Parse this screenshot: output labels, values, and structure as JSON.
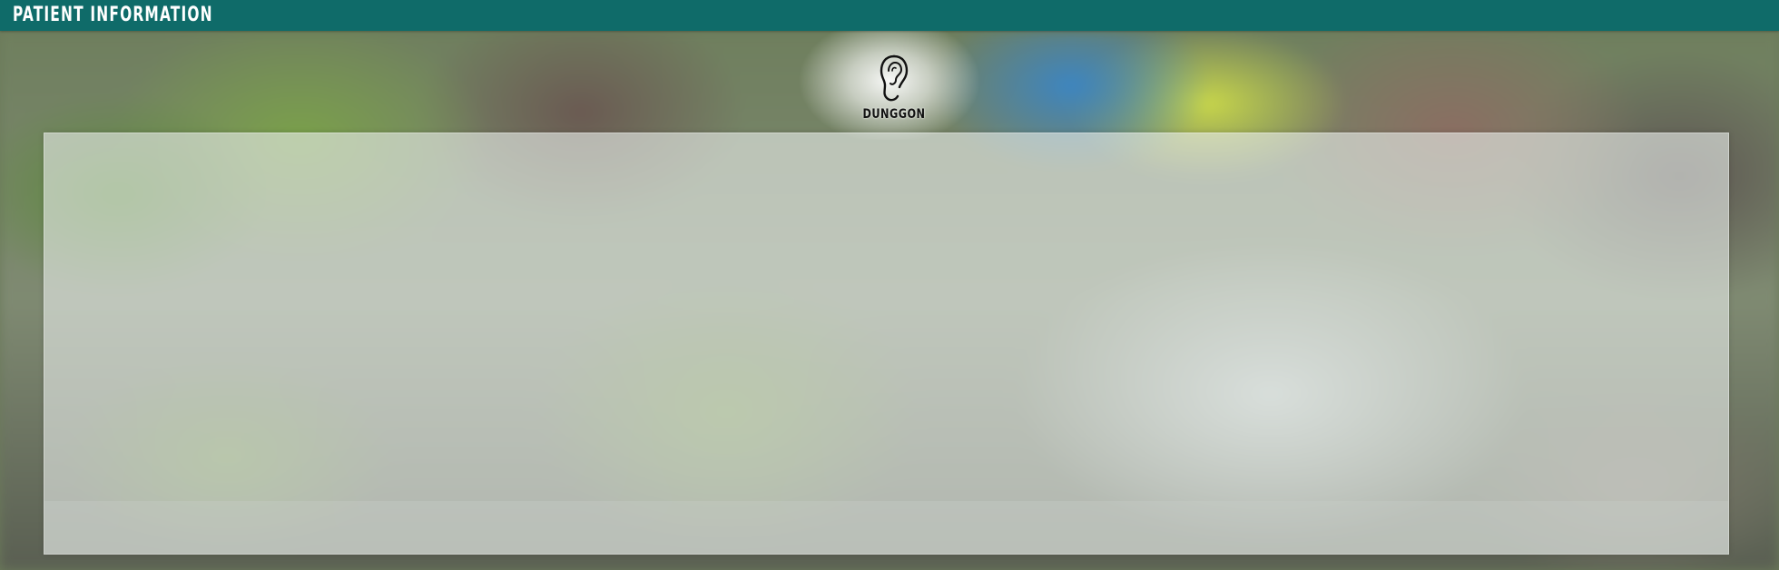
{
  "header": {
    "title": "PATIENT INFORMATION",
    "background_color": "#0f6b69",
    "text_color": "#ffffff"
  },
  "logo": {
    "icon": "ear-icon",
    "label": "DUNGGON"
  },
  "main_panel": {
    "style": "frosted-glass"
  }
}
